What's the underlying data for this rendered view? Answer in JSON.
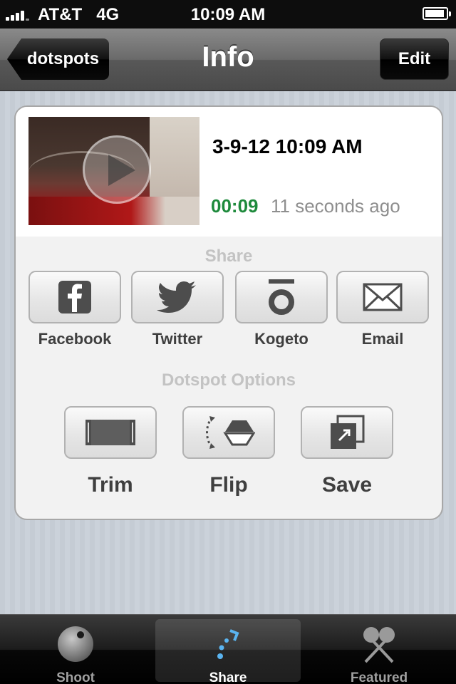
{
  "status": {
    "carrier": "AT&T   4G",
    "time": "10:09 AM"
  },
  "nav": {
    "back_label": "dotspots",
    "title": "Info",
    "edit_label": "Edit"
  },
  "clip": {
    "date": "3-9-12 10:09 AM",
    "duration": "00:09",
    "ago": "11 seconds ago"
  },
  "share": {
    "header": "Share",
    "buttons": [
      {
        "label": "Facebook",
        "icon": "facebook-icon"
      },
      {
        "label": "Twitter",
        "icon": "twitter-bird-icon"
      },
      {
        "label": "Kogeto",
        "icon": "kogeto-icon"
      },
      {
        "label": "Email",
        "icon": "envelope-icon"
      }
    ]
  },
  "options": {
    "header": "Dotspot Options",
    "buttons": [
      {
        "label": "Trim",
        "icon": "film-trim-icon"
      },
      {
        "label": "Flip",
        "icon": "flip-icon"
      },
      {
        "label": "Save",
        "icon": "save-export-icon"
      }
    ]
  },
  "tabs": [
    {
      "label": "Shoot",
      "icon": "shoot-camera-icon",
      "selected": false
    },
    {
      "label": "Share",
      "icon": "share-dots-icon",
      "selected": true
    },
    {
      "label": "Featured",
      "icon": "featured-crossed-icon",
      "selected": false
    }
  ],
  "colors": {
    "duration": "#1e8a3c",
    "muted_text": "#8e8e8e",
    "section_label": "#c3c3c3",
    "share_tab_accent": "#5ab4f0"
  }
}
